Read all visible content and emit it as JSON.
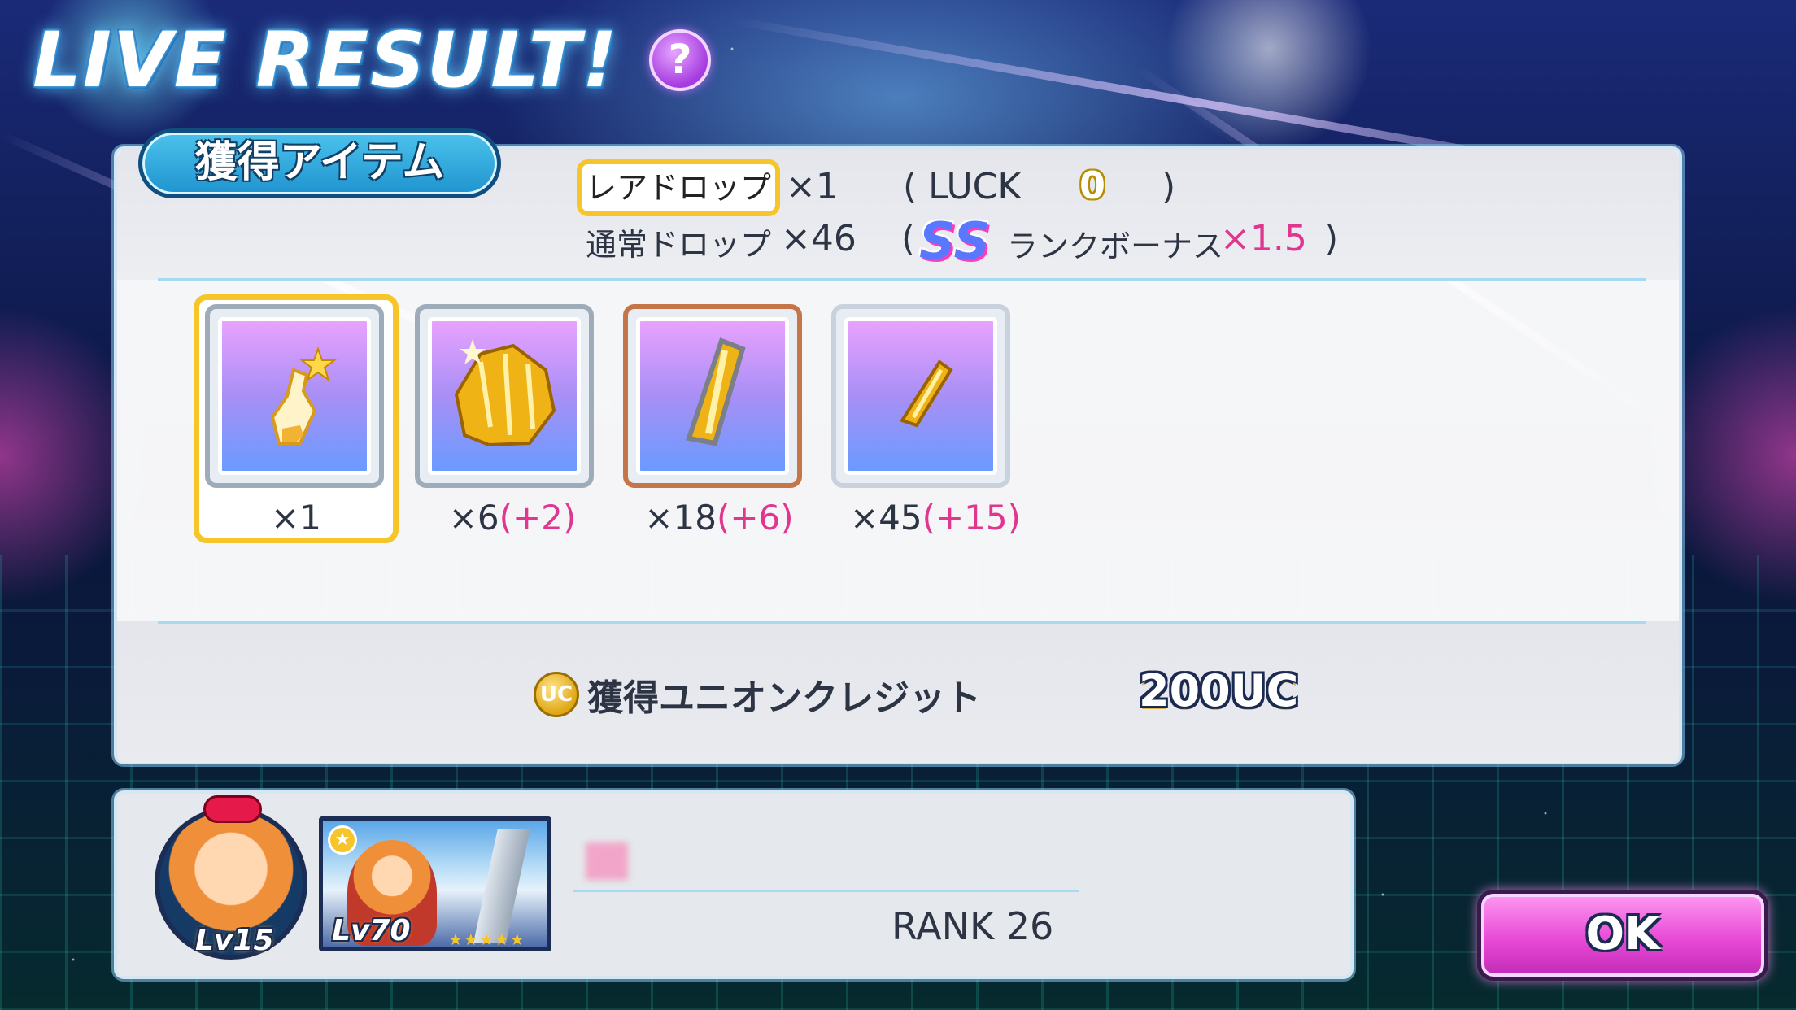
{
  "header": {
    "title": "LIVE RESULT!",
    "help_icon": "?"
  },
  "items_section": {
    "tab_label": "獲得アイテム",
    "rare_drop_label": "レアドロップ",
    "rare_drop_count": "×1",
    "luck_open": "( LUCK",
    "luck_value": "0",
    "luck_close": ")",
    "normal_drop_label": "通常ドロップ",
    "normal_drop_count": "×46",
    "bonus_open": "(",
    "rank_logo": "SS",
    "rank_bonus_label": "ランクボーナス",
    "rank_bonus_multiplier": "×1.5",
    "bonus_close": ")",
    "items": [
      {
        "icon": "star-flask-icon",
        "qty": "×1",
        "bonus": ""
      },
      {
        "icon": "gold-crystal-cluster-icon",
        "qty": "×6",
        "bonus": "(+2)"
      },
      {
        "icon": "gold-crystal-icon",
        "qty": "×18",
        "bonus": "(+6)"
      },
      {
        "icon": "gold-shard-icon",
        "qty": "×45",
        "bonus": "(+15)"
      }
    ]
  },
  "credit": {
    "coin_icon": "UC",
    "label": "獲得ユニオンクレジット",
    "value": "200UC"
  },
  "player": {
    "avatar_level": "Lv15",
    "card_level": "Lv70",
    "card_stars": "★★★★★",
    "rank": "RANK 26"
  },
  "ok_button": "OK",
  "colors": {
    "accent_pink": "#e0368f",
    "rare_gold": "#f6c52a",
    "tab_blue": "#1f93cf"
  }
}
